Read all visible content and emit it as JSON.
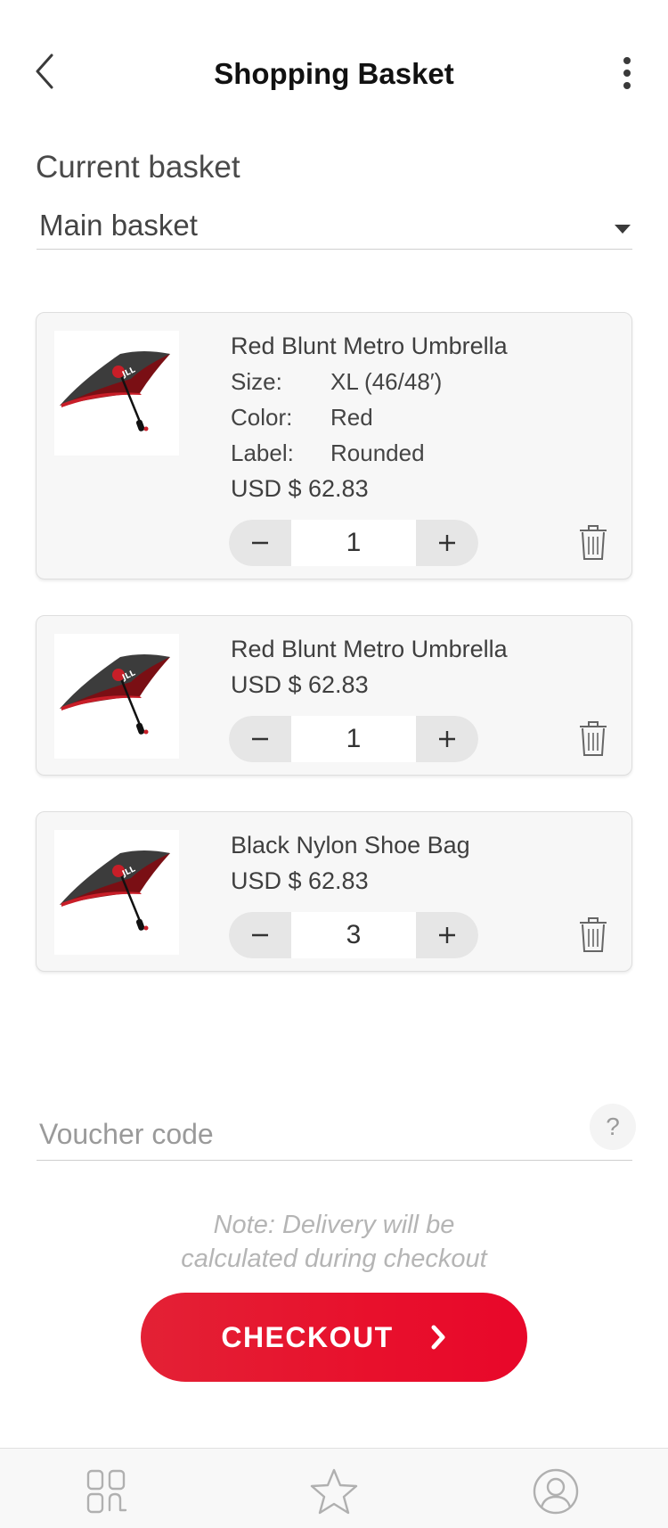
{
  "header": {
    "title": "Shopping Basket"
  },
  "basket": {
    "section_label": "Current basket",
    "selected": "Main basket"
  },
  "items": [
    {
      "title": "Red Blunt Metro Umbrella",
      "attributes": [
        {
          "label": "Size:",
          "value": "XL (46/48′)"
        },
        {
          "label": "Color:",
          "value": "Red"
        },
        {
          "label": "Label:",
          "value": "Rounded"
        }
      ],
      "price": "USD $ 62.83",
      "quantity": "1"
    },
    {
      "title": "Red Blunt Metro Umbrella",
      "price": "USD $ 62.83",
      "quantity": "1"
    },
    {
      "title": "Black Nylon Shoe Bag",
      "price": "USD $ 62.83",
      "quantity": "3"
    }
  ],
  "thumbnail_logo": "JLL",
  "stepper": {
    "minus": "−",
    "plus": "+"
  },
  "voucher": {
    "placeholder": "Voucher code",
    "help": "?"
  },
  "note": {
    "line1": "Note: Delivery will be",
    "line2": "calculated during checkout"
  },
  "checkout": {
    "label": "CHECKOUT"
  },
  "tabbar": {
    "icons": [
      "grid-icon",
      "star-icon",
      "profile-icon"
    ]
  },
  "colors": {
    "accent": "#e8102c",
    "card_bg": "#f7f7f7",
    "stepper_bg": "#e6e6e6"
  }
}
